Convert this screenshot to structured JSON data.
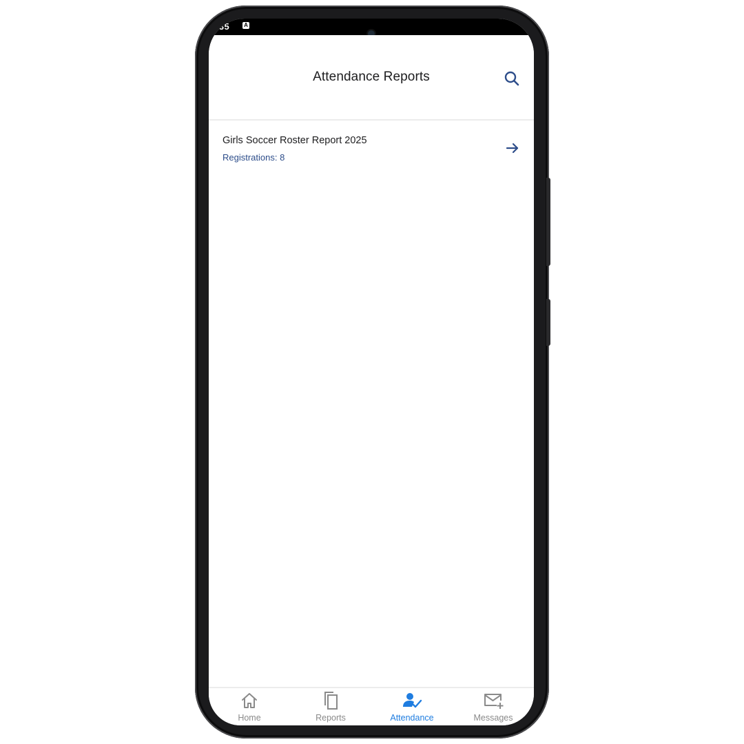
{
  "status_bar": {
    "time": ":35",
    "notification_icon_glyph": "A"
  },
  "header": {
    "title": "Attendance Reports",
    "search_icon": "search-icon"
  },
  "reports": [
    {
      "title": "Girls Soccer Roster Report 2025",
      "subtitle": "Registrations: 8",
      "icon": "arrow-right-icon"
    }
  ],
  "bottom_nav": {
    "items": [
      {
        "label": "Home",
        "icon": "home-icon",
        "active": false
      },
      {
        "label": "Reports",
        "icon": "copy-icon",
        "active": false
      },
      {
        "label": "Attendance",
        "icon": "person-check-icon",
        "active": true
      },
      {
        "label": "Messages",
        "icon": "mail-plus-icon",
        "active": false
      }
    ]
  },
  "colors": {
    "accent_blue": "#1f7de0",
    "dark_blue": "#2d4d8a",
    "inactive_gray": "#8a8a8a",
    "text_dark": "#1d1d1f"
  }
}
